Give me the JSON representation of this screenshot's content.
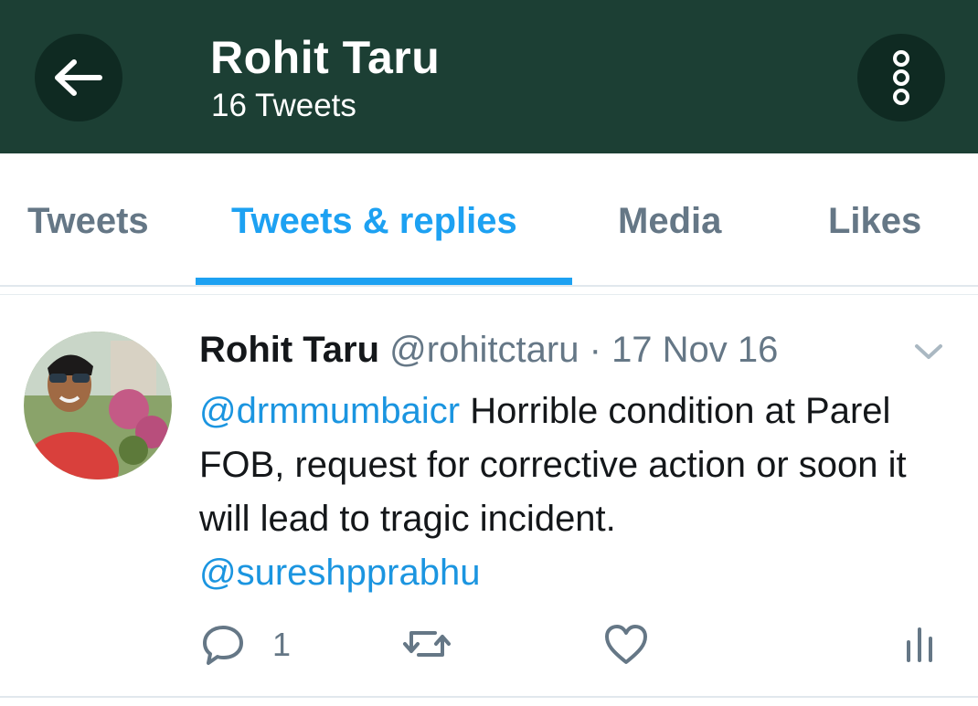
{
  "header": {
    "title": "Rohit Taru",
    "subtitle": "16 Tweets",
    "colors": {
      "background": "#1c3f34",
      "button_bg": "#0f2a22"
    },
    "icons": {
      "back": "arrow-left-icon",
      "more": "more-vertical-icon"
    }
  },
  "tabs": [
    {
      "label": "Tweets",
      "active": false
    },
    {
      "label": "Tweets & replies",
      "active": true
    },
    {
      "label": "Media",
      "active": false
    },
    {
      "label": "Likes",
      "active": false
    }
  ],
  "tweet": {
    "name": "Rohit Taru",
    "handle": "@rohitctaru",
    "separator": "·",
    "date": "17 Nov 16",
    "mention1": "@drmmumbaicr",
    "text": " Horrible condition at Parel FOB, request for corrective action or soon it will lead to tragic incident.",
    "mention2": "@sureshpprabhu",
    "reply_count": "1",
    "icons": {
      "menu": "chevron-down-icon",
      "reply": "reply-icon",
      "retweet": "retweet-icon",
      "like": "heart-icon",
      "stats": "analytics-icon"
    }
  },
  "colors": {
    "accent": "#1da1f2",
    "mention": "#1b95e0",
    "muted": "#657786"
  }
}
